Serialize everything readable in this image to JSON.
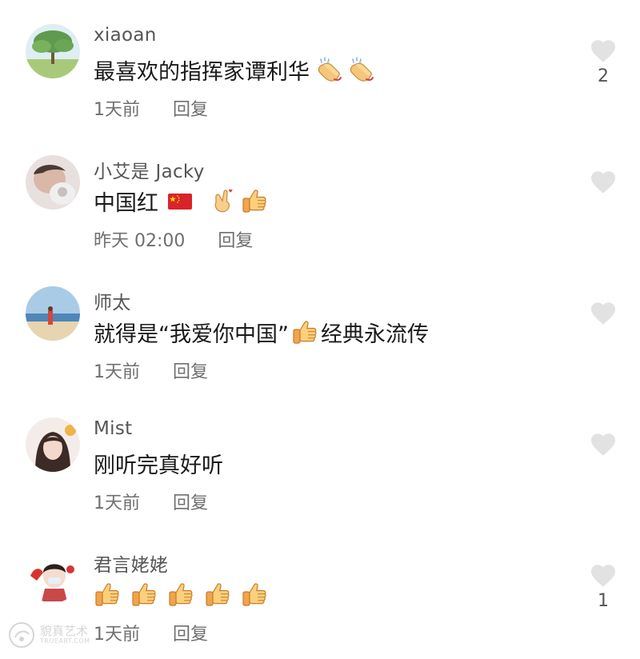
{
  "colors": {
    "text_primary": "#1a1a1a",
    "text_secondary": "#6f6f6f",
    "heart": "#e2e2e2"
  },
  "comments": [
    {
      "username": "xiaoan",
      "text": "最喜欢的指挥家谭利华",
      "emojis_after": [
        "clapping-hands-emoji",
        "clapping-hands-emoji"
      ],
      "time": "1天前",
      "reply": "回复",
      "likes": "2"
    },
    {
      "username": "小艾是 Jacky",
      "text": "中国红",
      "emojis_after": [
        "china-flag-emoji",
        "finger-heart-emoji",
        "thumbs-up-emoji"
      ],
      "time": "昨天 02:00",
      "reply": "回复",
      "likes": ""
    },
    {
      "username": "师太",
      "text_before": "就得是“我爱你中国”",
      "emoji_middle": "thumbs-up-emoji",
      "text_after": "经典永流传",
      "time": "1天前",
      "reply": "回复",
      "likes": ""
    },
    {
      "username": "Mist",
      "text": "刚听完真好听",
      "time": "1天前",
      "reply": "回复",
      "likes": ""
    },
    {
      "username": "君言姥姥",
      "emojis": [
        "thumbs-up-emoji",
        "thumbs-up-emoji",
        "thumbs-up-emoji",
        "thumbs-up-emoji",
        "thumbs-up-emoji"
      ],
      "time": "1天前",
      "reply": "回复",
      "likes": "1"
    }
  ],
  "watermark": {
    "cn": "貌真艺术",
    "en": "TRUEART.COM"
  }
}
